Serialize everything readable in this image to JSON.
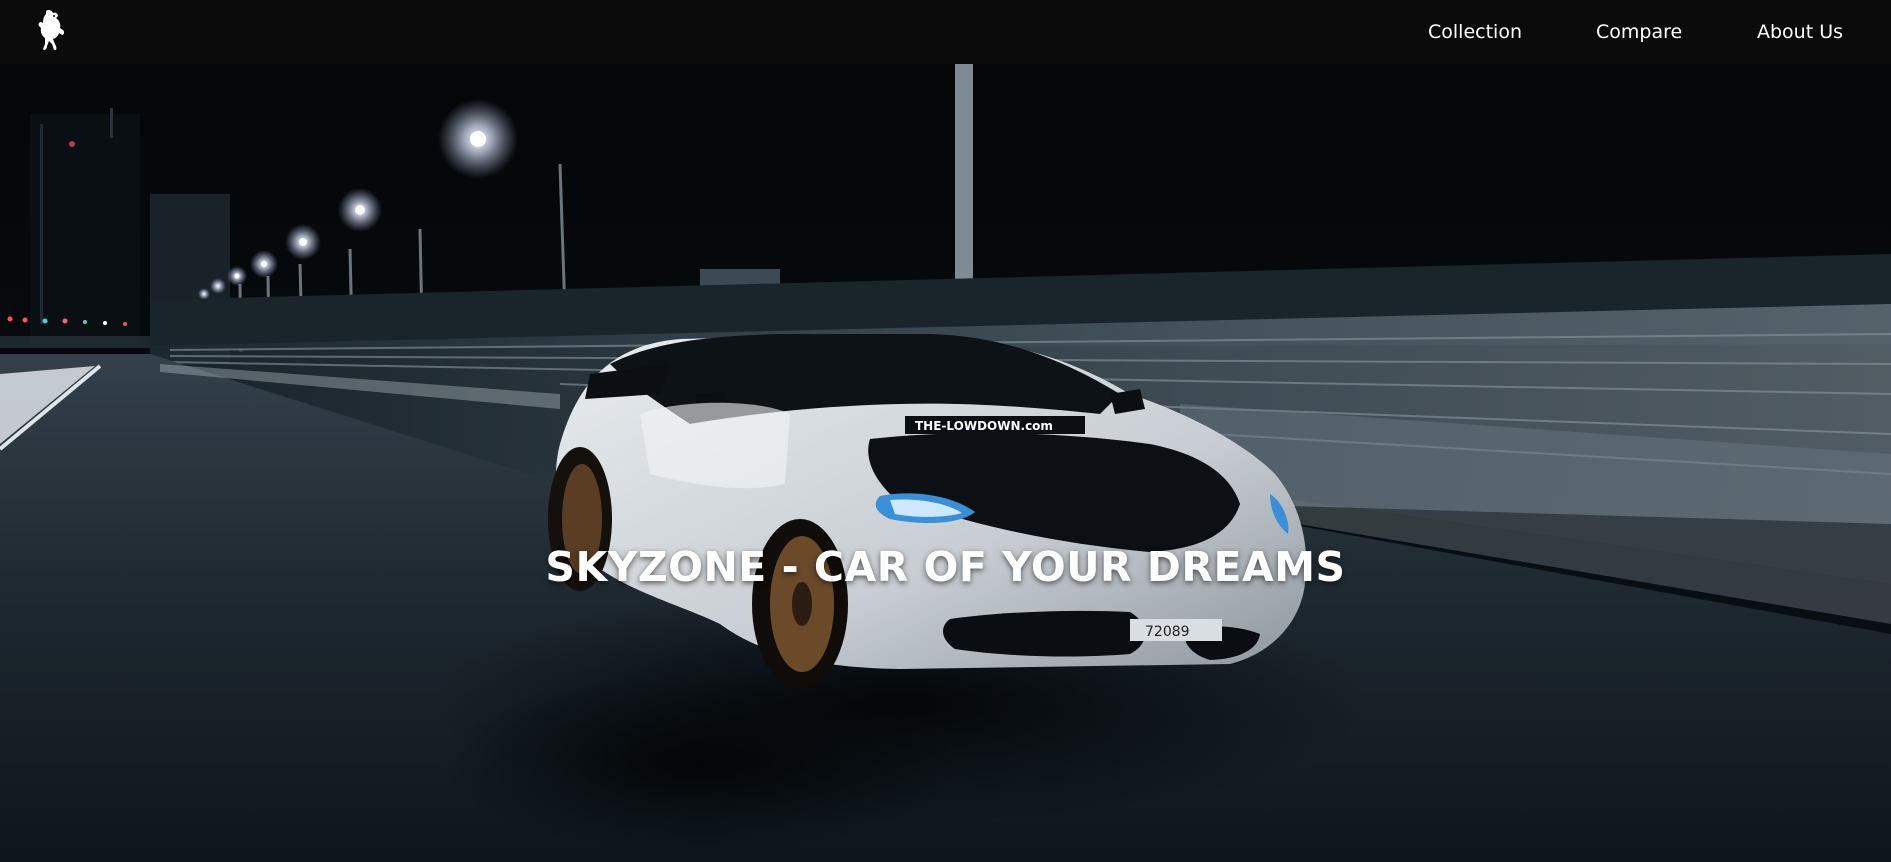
{
  "navbar": {
    "logo_icon": "prancing-horse-icon",
    "links": [
      {
        "label": "Collection"
      },
      {
        "label": "Compare"
      },
      {
        "label": "About Us"
      }
    ]
  },
  "hero": {
    "title": "SKYZONE - CAR OF YOUR DREAMS",
    "image_description_icon": "sports-car-night-bridge-image",
    "windshield_banner": "THE-LOWDOWN.com",
    "plate": "72089"
  },
  "colors": {
    "navbar_bg": "#0b0b0b",
    "hero_bg": "#05080b",
    "text": "#ffffff"
  }
}
